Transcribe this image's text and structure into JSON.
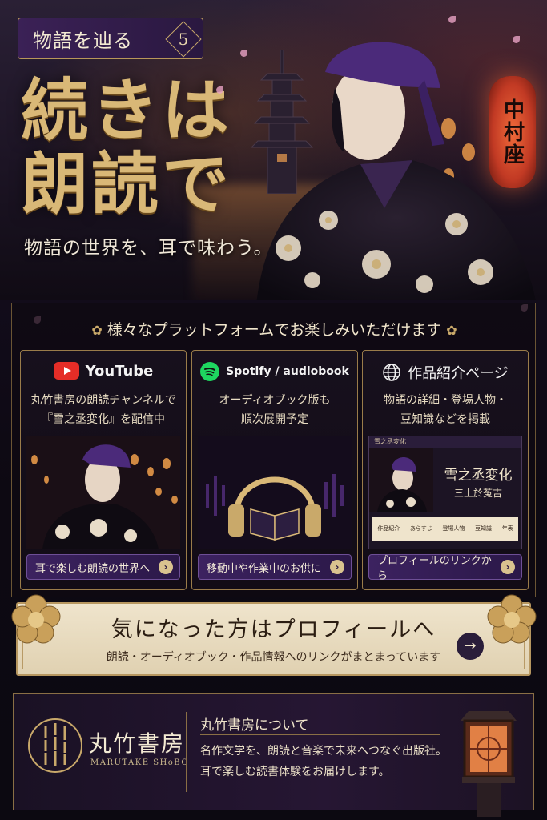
{
  "hero": {
    "badge_text": "物語を辿る",
    "badge_number": "5",
    "headline_line1": "続きは",
    "headline_line2": "朗読で",
    "subcopy": "物語の世界を、耳で味わう。",
    "lantern_sign": "中村座"
  },
  "platforms": {
    "heading": "様々なプラットフォームでお楽しみいただけます",
    "heading_ornament": "✿",
    "cards": [
      {
        "title": "YouTube",
        "icon": "youtube-icon",
        "desc_line1": "丸竹書房の朗読チャンネルで",
        "desc_line2": "『雪之丞変化』を配信中",
        "cta": "耳で楽しむ朗読の世界へ"
      },
      {
        "title": "Spotify / audiobook",
        "icon": "spotify-icon",
        "desc_line1": "オーディオブック版も",
        "desc_line2": "順次展開予定",
        "cta": "移動中や作業中のお供に"
      },
      {
        "title": "作品紹介ページ",
        "icon": "globe-icon",
        "desc_line1": "物語の詳細・登場人物・",
        "desc_line2": "豆知識などを掲載",
        "cta": "プロフィールのリンクから",
        "preview": {
          "site_label": "雪之丞変化",
          "title": "雪之丞変化",
          "author": "三上於菟吉",
          "tabs": [
            "作品紹介",
            "あらすじ",
            "登場人物",
            "豆知識",
            "年表"
          ]
        }
      }
    ]
  },
  "banner": {
    "title": "気になった方はプロフィールへ",
    "subtitle": "朗読・オーディオブック・作品情報へのリンクがまとまっています",
    "arrow": "→"
  },
  "footer": {
    "brand_name": "丸竹書房",
    "brand_roman": "MARUTAKE SHoBO",
    "about_title": "丸竹書房について",
    "about_line1": "名作文学を、朗読と音楽で未来へつなぐ出版社。",
    "about_line2": "耳で楽しむ読書体験をお届けします。"
  },
  "colors": {
    "gold": "#d9b877",
    "purple": "#3c2260",
    "background": "#0d0912",
    "youtube_red": "#e52d27",
    "spotify_green": "#1ed760"
  }
}
